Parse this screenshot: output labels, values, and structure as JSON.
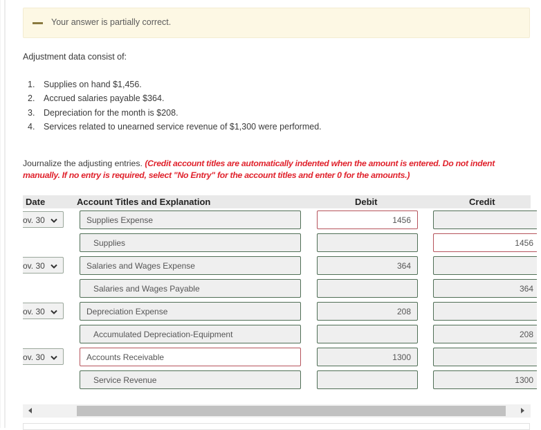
{
  "feedback": {
    "icon": "minus-icon",
    "message": "Your answer is partially correct."
  },
  "intro": "Adjustment data consist of:",
  "adjustments": [
    {
      "num": "1.",
      "text": "Supplies on hand $1,456."
    },
    {
      "num": "2.",
      "text": "Accrued salaries payable $364."
    },
    {
      "num": "3.",
      "text": "Depreciation for the month is $208."
    },
    {
      "num": "4.",
      "text": "Services related to unearned service revenue of $1,300 were performed."
    }
  ],
  "instructions": {
    "plain": "Journalize the adjusting entries. ",
    "note": "(Credit account titles are automatically indented when the amount is entered. Do not indent manually. If no entry is required, select \"No Entry\" for the account titles and enter 0 for the amounts.)"
  },
  "table": {
    "headers": {
      "date": "Date",
      "account": "Account Titles and Explanation",
      "debit": "Debit",
      "credit": "Credit"
    },
    "rows": [
      {
        "date": "ov. 30",
        "account": "Supplies Expense",
        "debit": "1456",
        "credit": "",
        "account_status": "correct",
        "debit_status": "incorrect",
        "credit_status": "correct"
      },
      {
        "date": "",
        "account": "Supplies",
        "debit": "",
        "credit": "1456",
        "account_status": "correct",
        "debit_status": "correct",
        "credit_status": "incorrect"
      },
      {
        "date": "ov. 30",
        "account": "Salaries and Wages Expense",
        "debit": "364",
        "credit": "",
        "account_status": "correct",
        "debit_status": "correct",
        "credit_status": "correct"
      },
      {
        "date": "",
        "account": "Salaries and Wages Payable",
        "debit": "",
        "credit": "364",
        "account_status": "correct",
        "debit_status": "correct",
        "credit_status": "correct"
      },
      {
        "date": "ov. 30",
        "account": "Depreciation Expense",
        "debit": "208",
        "credit": "",
        "account_status": "correct",
        "debit_status": "correct",
        "credit_status": "correct"
      },
      {
        "date": "",
        "account": "Accumulated Depreciation-Equipment",
        "debit": "",
        "credit": "208",
        "account_status": "correct",
        "debit_status": "correct",
        "credit_status": "correct"
      },
      {
        "date": "ov. 30",
        "account": "Accounts Receivable",
        "debit": "1300",
        "credit": "",
        "account_status": "incorrect",
        "debit_status": "correct",
        "credit_status": "correct"
      },
      {
        "date": "",
        "account": "Service Revenue",
        "debit": "",
        "credit": "1300",
        "account_status": "correct",
        "debit_status": "correct",
        "credit_status": "correct"
      }
    ]
  },
  "colors": {
    "correct_border": "#4f6e55",
    "incorrect_border": "#b5525a",
    "note_red": "#e0232d",
    "feedback_bg": "#fdf8e4"
  }
}
